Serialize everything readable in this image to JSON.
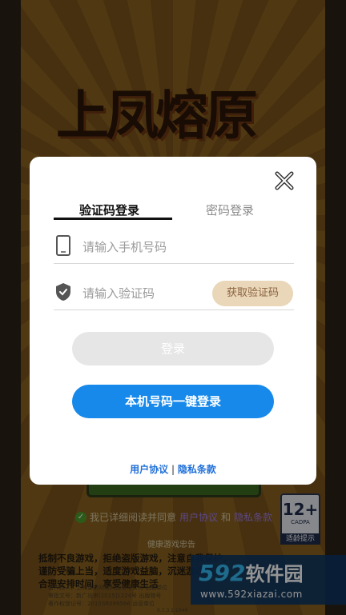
{
  "background": {
    "game_title": "上凤熔原",
    "agree_prefix": "我已详细阅读并同意",
    "agree_user_link": "用户协议",
    "agree_and": "和",
    "agree_privacy_link": "隐私条款",
    "health_title": "健康游戏忠告",
    "health_text": "抵制不良游戏，拒绝盗版游戏，注意自我保护，谨防受骗上当，适度游戏益脑，沉迷游戏伤身，合理安排时间，享受健康生活",
    "publisher_line1": "著作权人：上海星初网络科技有限公司  出版单位",
    "publisher_line2": "审批文号：新广出审[2015]1224号  出版物号",
    "publisher_line3": "著作权登记号：2015SR099566  运营单位",
    "version": "0.7.3.1.1044",
    "age_rating": "12+",
    "age_org": "CADPA",
    "age_tip": "适龄提示",
    "watermark_brand": "592",
    "watermark_cn": "软件园",
    "watermark_url": "www.592xiazai.com"
  },
  "dialog": {
    "tab_sms": "验证码登录",
    "tab_password": "密码登录",
    "phone_placeholder": "请输入手机号码",
    "code_placeholder": "请输入验证码",
    "get_code_label": "获取验证码",
    "login_label": "登录",
    "onekey_label": "本机号码一键登录",
    "user_agreement": "用户协议",
    "separator": "|",
    "privacy_policy": "隐私条款"
  },
  "colors": {
    "primary_button": "#1689ea",
    "disabled_button": "#e6e6e6",
    "get_code_bg": "#ead6b8",
    "link": "#1f6fd8"
  }
}
